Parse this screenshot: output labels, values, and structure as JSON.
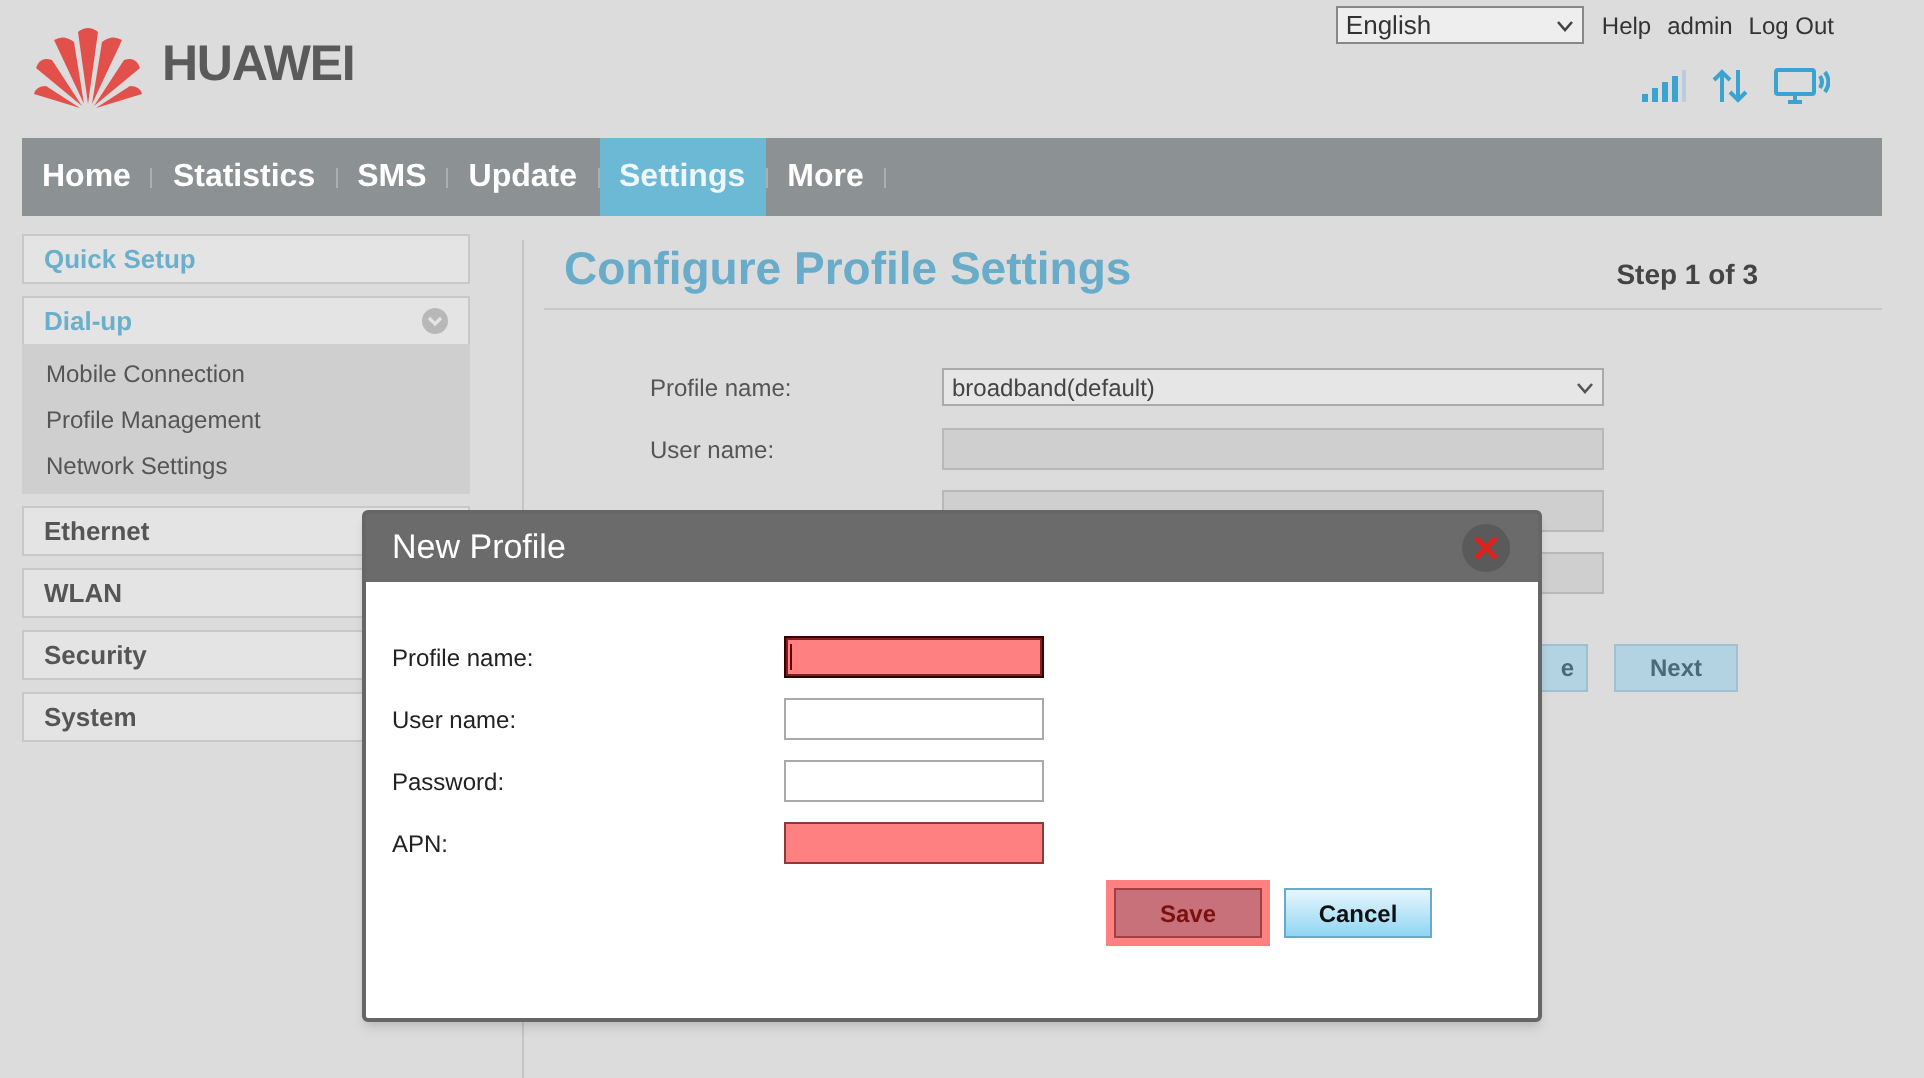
{
  "header": {
    "brand": "HUAWEI",
    "language": "English",
    "links": [
      "Help",
      "admin",
      "Log Out"
    ]
  },
  "nav": [
    {
      "label": "Home",
      "selected": false
    },
    {
      "label": "Statistics",
      "selected": false
    },
    {
      "label": "SMS",
      "selected": false
    },
    {
      "label": "Update",
      "selected": false
    },
    {
      "label": "Settings",
      "selected": true
    },
    {
      "label": "More",
      "selected": false
    }
  ],
  "sidebar": [
    {
      "label": "Quick Setup",
      "selected": true,
      "expanded": false
    },
    {
      "label": "Dial-up",
      "selected": true,
      "expanded": true,
      "children": [
        {
          "label": "Mobile Connection"
        },
        {
          "label": "Profile Management"
        },
        {
          "label": "Network Settings"
        }
      ]
    },
    {
      "label": "Ethernet",
      "selected": false,
      "expanded": false
    },
    {
      "label": "WLAN",
      "selected": false,
      "expanded": false
    },
    {
      "label": "Security",
      "selected": false,
      "expanded": false
    },
    {
      "label": "System",
      "selected": false,
      "expanded": false
    }
  ],
  "page": {
    "title": "Configure Profile Settings",
    "step": "Step 1 of 3",
    "fields": [
      {
        "kind": "select",
        "label": "Profile name:",
        "value": "broadband(default)"
      },
      {
        "kind": "text",
        "label": "User name:",
        "disabled": true
      },
      {
        "kind": "text",
        "disabled": true
      },
      {
        "kind": "text",
        "disabled": true
      }
    ],
    "buttons": [
      "e",
      "Next"
    ]
  },
  "dialog": {
    "title": "New Profile",
    "fields": [
      {
        "label": "Profile name:",
        "invalid": true,
        "focused": true
      },
      {
        "label": "User name:",
        "invalid": false,
        "focused": false
      },
      {
        "label": "Password:",
        "invalid": false,
        "focused": false
      },
      {
        "label": "APN:",
        "invalid": true,
        "focused": false
      }
    ],
    "buttons": [
      {
        "label": "Save",
        "kind": "primary",
        "invalid": true
      },
      {
        "label": "Cancel",
        "kind": "secondary",
        "invalid": false
      }
    ]
  }
}
